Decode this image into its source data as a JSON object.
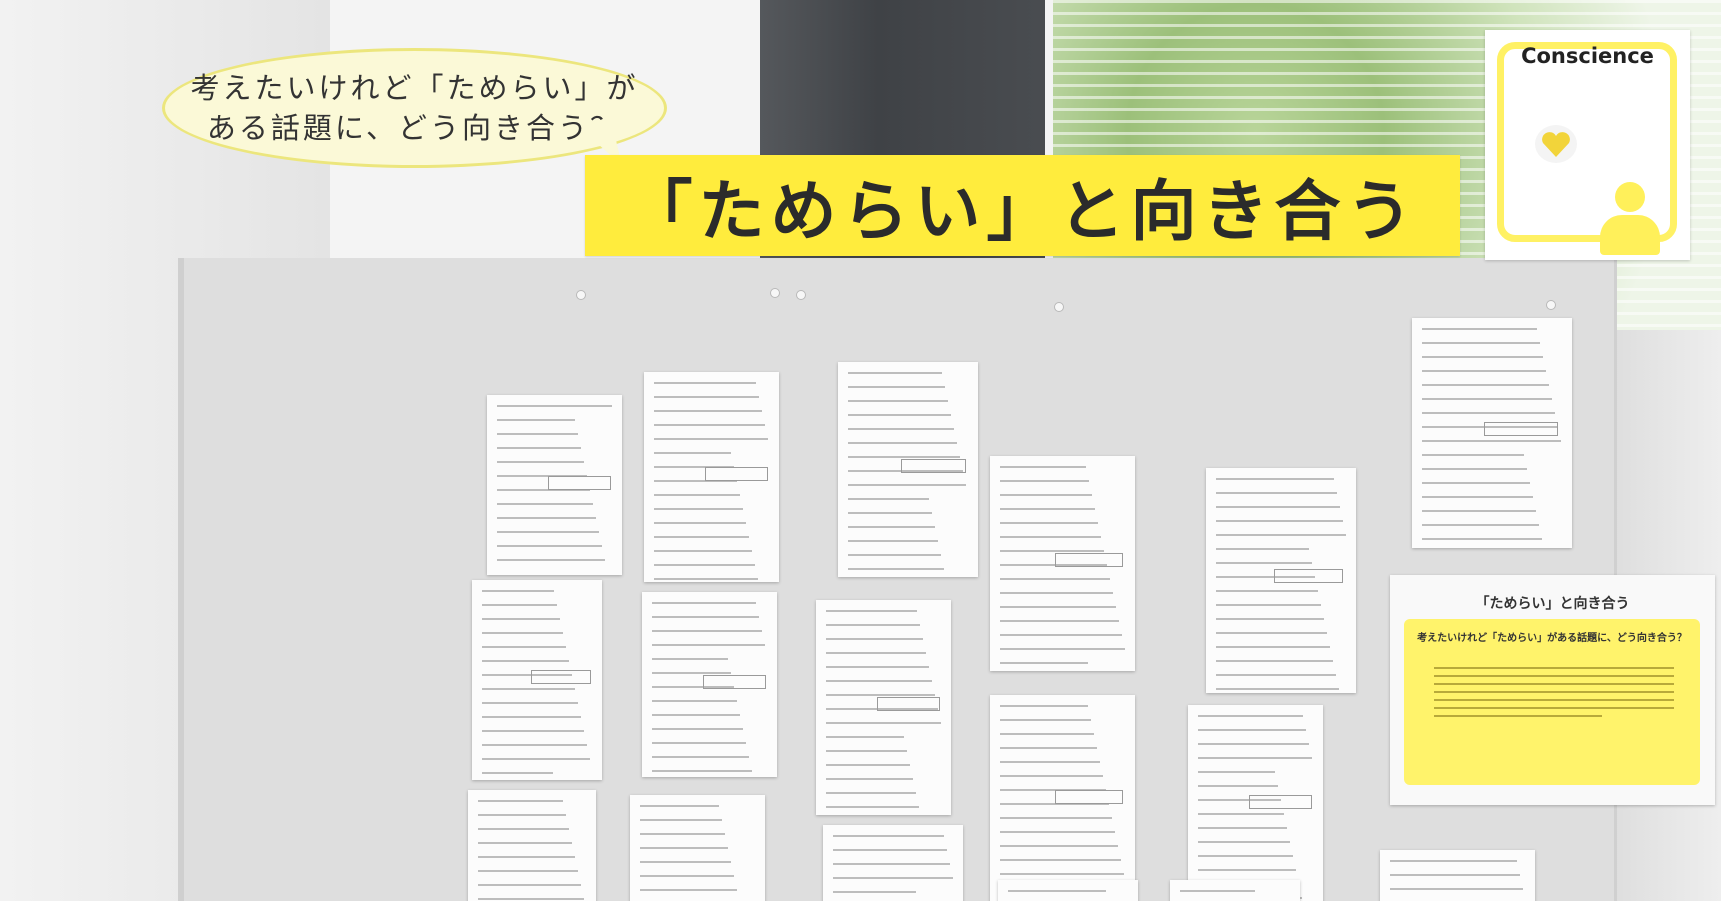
{
  "speech_bubble": {
    "line1": "考えたいけれど「ためらい」が",
    "line2": "ある話題に、どう向き合う？"
  },
  "banner": {
    "title": "「ためらい」と向き合う"
  },
  "corner_sign": {
    "label": "Conscience",
    "icon": "heart-thought-person"
  },
  "info_panel": {
    "title": "「ためらい」と向き合う",
    "heading": "考えたいけれど「ためらい」がある話題に、どう向き合う？"
  },
  "colors": {
    "banner_yellow": "#ffec3d",
    "bubble_fill": "#fbf9d7",
    "bubble_border": "#ece67d",
    "board_gray": "#dedede",
    "text_dark": "#2b2b2b"
  }
}
